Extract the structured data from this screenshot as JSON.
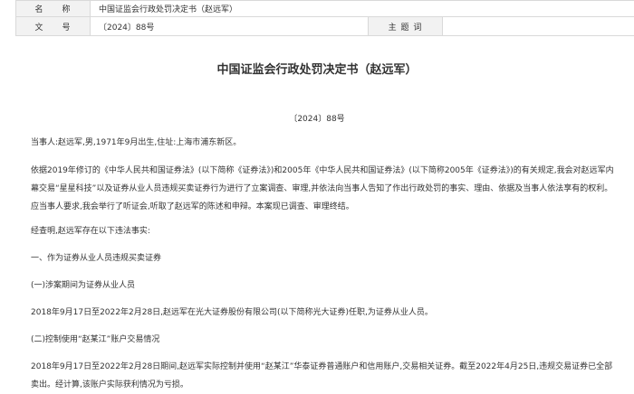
{
  "meta": {
    "name_label": "名　　称",
    "name_value": "中国证监会行政处罚决定书（赵远军）",
    "number_label": "文　　号",
    "number_value": "〔2024〕88号",
    "subject_label": "主 题 词",
    "subject_value": ""
  },
  "document": {
    "title": "中国证监会行政处罚决定书（赵远军）",
    "number": "〔2024〕88号",
    "paragraphs": [
      "当事人:赵远军,男,1971年9月出生,住址:上海市浦东新区。",
      "依据2019年修订的《中华人民共和国证券法》(以下简称《证券法》)和2005年《中华人民共和国证券法》(以下简称2005年《证券法》)的有关规定,我会对赵远军内幕交易“星星科技”以及证券从业人员违规买卖证券行为进行了立案调查、审理,并依法向当事人告知了作出行政处罚的事实、理由、依据及当事人依法享有的权利。应当事人要求,我会举行了听证会,听取了赵远军的陈述和申辩。本案现已调查、审理终结。",
      "经查明,赵远军存在以下违法事实:",
      "一、作为证券从业人员违规买卖证券",
      "(一)涉案期间为证券从业人员",
      "2018年9月17日至2022年2月28日,赵远军在光大证券股份有限公司(以下简称光大证券)任职,为证券从业人员。",
      "(二)控制使用“赵某江”账户交易情况",
      "2018年9月17日至2022年2月28日期间,赵远军实际控制并使用“赵某江”华泰证券普通账户和信用账户,交易相关证券。截至2022年4月25日,违规交易证券已全部卖出。经计算,该账户实际获利情况为亏损。"
    ]
  }
}
